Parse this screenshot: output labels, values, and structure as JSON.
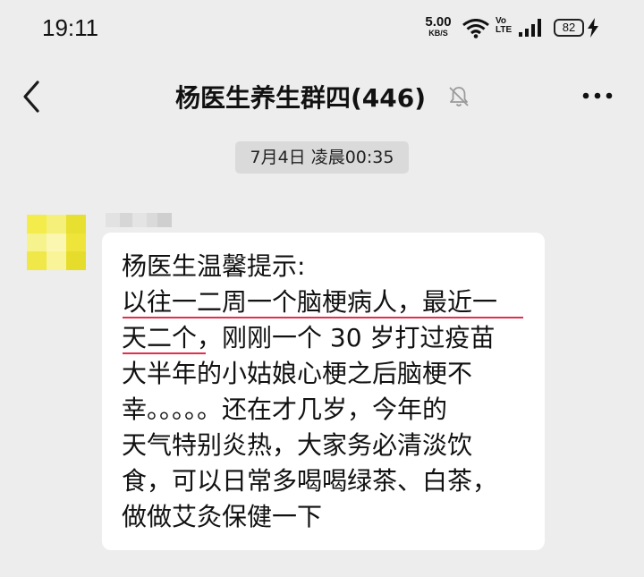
{
  "status_bar": {
    "time": "19:11",
    "net_speed": "5.00",
    "net_speed_unit": "KB/S",
    "volte_top": "Vo",
    "volte_bottom": "LTE",
    "battery": "82"
  },
  "nav": {
    "title": "杨医生养生群四(446)"
  },
  "chat": {
    "timestamp": "7月4日 凌晨00:35",
    "message": {
      "lines": [
        "杨医生温馨提示:",
        "以往一二周一个脑梗病人，最近一",
        "天二个，刚刚一个 30 岁打过疫苗",
        "大半年的小姑娘心梗之后脑梗不",
        "幸。。。。。还在才几岁，今年的",
        "天气特别炎热，大家务必清淡饮",
        "食，可以日常多喝喝绿茶、白茶，",
        "做做艾灸保健一下"
      ]
    }
  },
  "colors": {
    "background": "#ededed",
    "bubble": "#ffffff",
    "timestamp_pill": "#dadada",
    "underline": "#e0304e",
    "avatar_mosaic": [
      "#f3ec4a",
      "#f5f07a",
      "#e8e030",
      "#f7f38c",
      "#fbf6b0",
      "#eee43a",
      "#f0e848",
      "#f9f498",
      "#e6dc2c"
    ]
  },
  "icons": [
    "back-arrow",
    "mute-bell",
    "more-dots",
    "wifi",
    "cell-signal",
    "charging-bolt"
  ]
}
